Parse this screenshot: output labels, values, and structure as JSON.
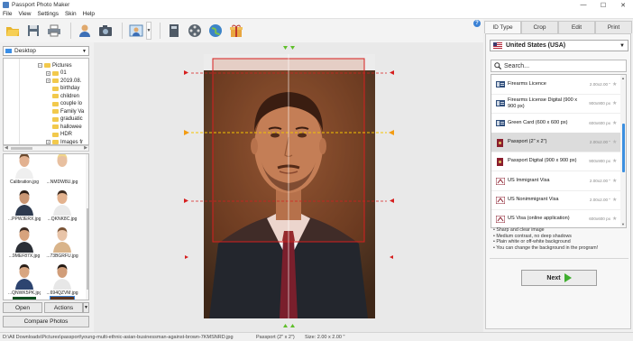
{
  "app": {
    "title": "Passport Photo Maker"
  },
  "window": {
    "minimize": "—",
    "maximize": "☐",
    "close": "✕"
  },
  "menu": [
    "File",
    "View",
    "Settings",
    "Skin",
    "Help"
  ],
  "left": {
    "folder": "Desktop",
    "tree": [
      {
        "label": "Pictures",
        "expander": "−",
        "depth": 0
      },
      {
        "label": "01",
        "expander": "+",
        "depth": 1
      },
      {
        "label": "2019.08.",
        "expander": "+",
        "depth": 1
      },
      {
        "label": "birthday",
        "expander": "",
        "depth": 1
      },
      {
        "label": "children",
        "expander": "",
        "depth": 1
      },
      {
        "label": "couple lo",
        "expander": "",
        "depth": 1
      },
      {
        "label": "Family Va",
        "expander": "",
        "depth": 1
      },
      {
        "label": "graduatic",
        "expander": "",
        "depth": 1
      },
      {
        "label": "hallowee",
        "expander": "",
        "depth": 1
      },
      {
        "label": "HDR",
        "expander": "",
        "depth": 1
      },
      {
        "label": "Images fr",
        "expander": "+",
        "depth": 1
      }
    ],
    "thumbnails": [
      "Calibration.jpg",
      "...NMDW8U.jpg",
      "...PPWJERX.jpg",
      "...QKNK8C.jpg",
      "...9MEF87X.jpg",
      "...73BGRFU.jpg",
      "...QNWK5PK.jpg",
      "...694QZVM.jpg",
      "...3UAF8RL.jpg",
      "...7KMSNRD.jpg"
    ],
    "open_label": "Open",
    "actions_label": "Actions",
    "compare_label": "Compare Photos"
  },
  "right": {
    "tabs": [
      "ID Type",
      "Crop",
      "Edit",
      "Print"
    ],
    "active_tab": "ID Type",
    "country": "United States (USA)",
    "search_placeholder": "Search...",
    "documents": [
      {
        "name": "Firearms Licence",
        "size": "2.00x2.00 \"",
        "star": "★"
      },
      {
        "name": "Firearms License Digital (900 x 900 px)",
        "size": "900x900 px",
        "star": "★"
      },
      {
        "name": "Green Card (600 x 600 px)",
        "size": "600x600 px",
        "star": "★"
      },
      {
        "name": "Passport (2\" x 2\")",
        "size": "2.00x2.00 \"",
        "star": "★"
      },
      {
        "name": "Passport Digital (900 x 900 px)",
        "size": "900x900 px",
        "star": "★"
      },
      {
        "name": "US Immigrant Visa",
        "size": "2.00x2.00 \"",
        "star": "★"
      },
      {
        "name": "US Nonimmigrant Visa",
        "size": "2.00x2.00 \"",
        "star": "★"
      },
      {
        "name": "US Visa (online application)",
        "size": "600x600 px",
        "star": "★"
      }
    ],
    "selected_document": "Passport (2\" x 2\")",
    "requirements": [
      "• Sharp and clear image",
      "• Medium contrast, no deep shadows",
      "• Plain white or off-white background",
      "• You can change the background in the program!"
    ],
    "next_label": "Next"
  },
  "status": {
    "path": "D:\\All Downloads\\Pictures\\passport\\young-multi-ethnic-asian-businessman-against-brown-7KMSNRD.jpg",
    "type": "Passport (2\" x 2\")",
    "size": "Size: 2.00 x 2.00 \""
  },
  "colors": {
    "accent": "#3b82d6",
    "crop_frame": "#d61f1f",
    "guide_green": "#5fbf2a",
    "guide_orange": "#f39c12",
    "eye_line": "#f5c400",
    "next_arrow": "#3fae2f"
  }
}
